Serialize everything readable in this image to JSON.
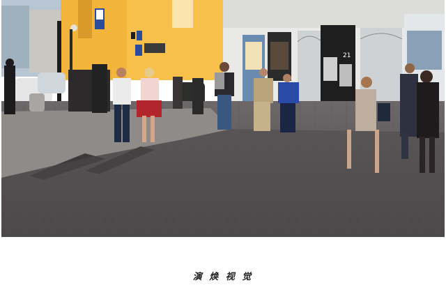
{
  "photo": {
    "description_icon": "street-photo",
    "poster_number": "21"
  },
  "caption": {
    "text": "演 焕 视 觉"
  },
  "colors": {
    "sky": "#b8c6d4",
    "yellow_building": "#f2b43a",
    "white_building": "#e9e9e7",
    "pavement_light": "#8f8b89",
    "pavement_shadow": "#4a4749",
    "frame": "#ffffff"
  }
}
